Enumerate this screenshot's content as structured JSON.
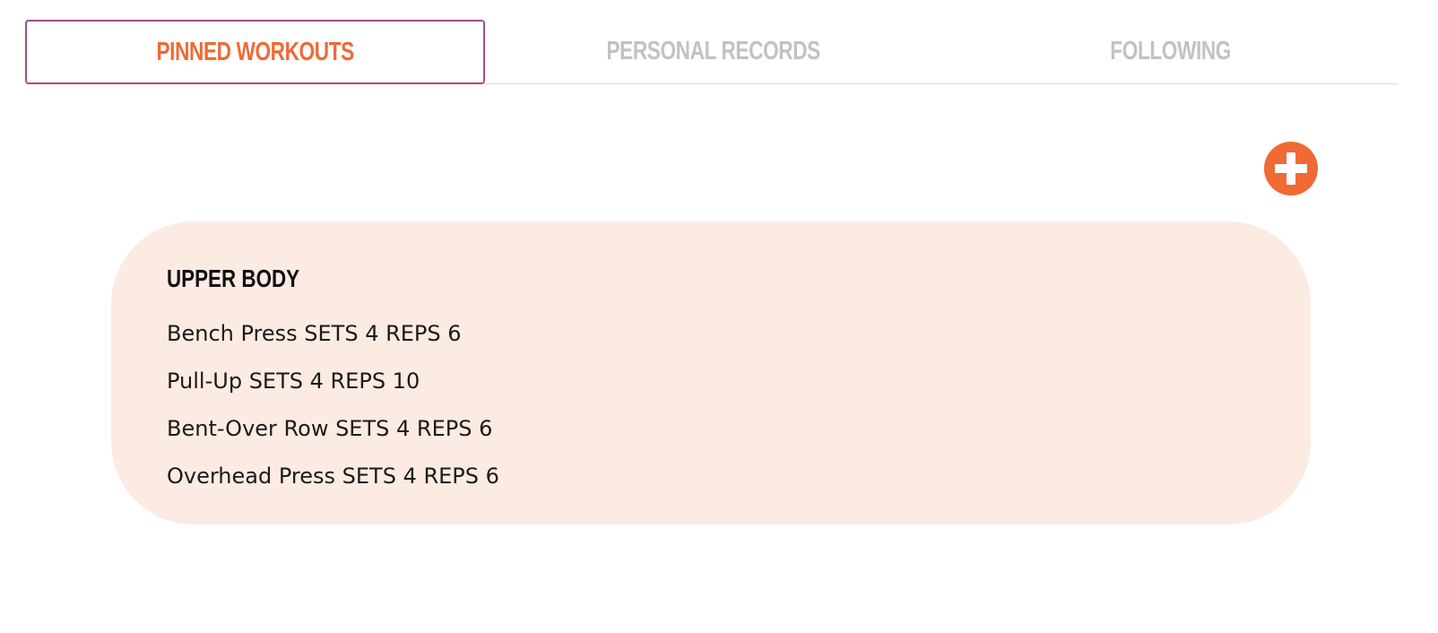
{
  "tabs": [
    {
      "label": "PINNED WORKOUTS",
      "active": true
    },
    {
      "label": "PERSONAL RECORDS",
      "active": false
    },
    {
      "label": "FOLLOWING",
      "active": false
    }
  ],
  "add_button": {
    "icon": "plus-icon",
    "color": "#ef6a35"
  },
  "workout": {
    "title": "UPPER BODY",
    "exercises": [
      "Bench Press SETS 4 REPS 6",
      "Pull-Up SETS 4 REPS 10",
      "Bent-Over Row SETS 4 REPS 6",
      "Overhead Press SETS 4 REPS 6"
    ]
  },
  "colors": {
    "accent": "#ee6a36",
    "active_tab_border": "#a24d8e",
    "inactive_tab": "#c2c2c2",
    "card_background": "#fbebe3"
  }
}
